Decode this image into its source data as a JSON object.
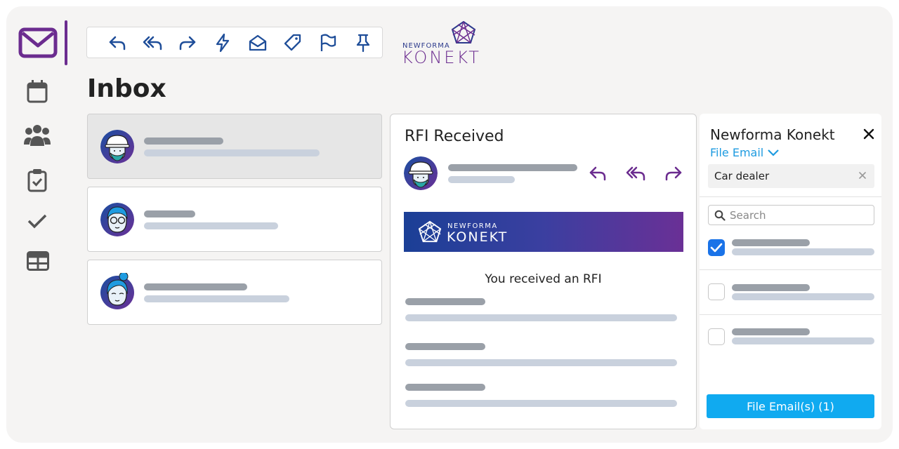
{
  "rail": {
    "items": [
      {
        "name": "mail-icon"
      },
      {
        "name": "calendar-icon"
      },
      {
        "name": "people-icon"
      },
      {
        "name": "tasks-icon"
      },
      {
        "name": "checkmark-icon"
      },
      {
        "name": "table-icon"
      }
    ],
    "accent": "#6b2c8f"
  },
  "toolbar": {
    "buttons": [
      "reply-icon",
      "reply-all-icon",
      "forward-icon",
      "lightning-icon",
      "open-envelope-icon",
      "tag-icon",
      "flag-icon",
      "pin-icon"
    ],
    "icon_color": "#1f4e99"
  },
  "logo": {
    "small": "NEWFORMA",
    "big": "KONEKT"
  },
  "inbox": {
    "title": "Inbox",
    "messages": [
      {
        "avatar": "construction-worker-avatar",
        "selected": true
      },
      {
        "avatar": "glasses-man-avatar",
        "selected": false
      },
      {
        "avatar": "woman-bun-avatar",
        "selected": false
      }
    ]
  },
  "reading_pane": {
    "title": "RFI Received",
    "actions": [
      "reply-icon",
      "reply-all-icon",
      "forward-icon"
    ],
    "action_color": "#6b2c8f",
    "banner": {
      "small": "NEWFORMA",
      "big": "KONEKT"
    },
    "body_text": "You received an RFI"
  },
  "panel": {
    "title": "Newforma Konekt",
    "file_email_link": "File Email",
    "chip_label": "Car dealer",
    "search_placeholder": "Search",
    "items": [
      {
        "checked": true
      },
      {
        "checked": false
      },
      {
        "checked": false
      }
    ],
    "file_button": "File Email(s) (1)",
    "link_color": "#1e9be0",
    "button_color": "#10aaf0"
  }
}
